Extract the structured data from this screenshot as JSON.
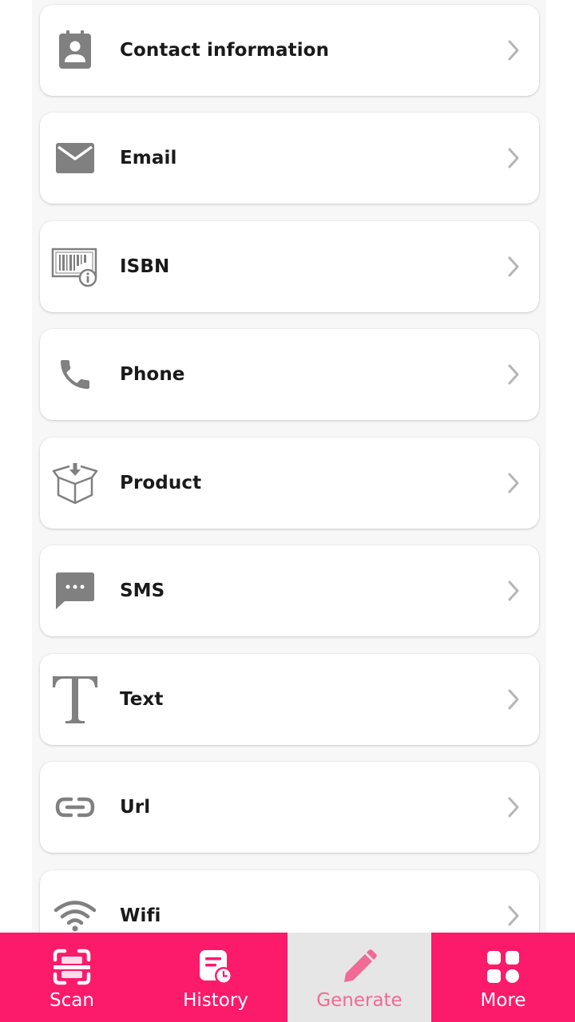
{
  "list": {
    "items": [
      {
        "label": "Contact information",
        "icon": "contact-card-icon"
      },
      {
        "label": "Email",
        "icon": "envelope-icon"
      },
      {
        "label": "ISBN",
        "icon": "barcode-info-icon"
      },
      {
        "label": "Phone",
        "icon": "phone-icon"
      },
      {
        "label": "Product",
        "icon": "box-icon"
      },
      {
        "label": "SMS",
        "icon": "chat-bubble-icon"
      },
      {
        "label": "Text",
        "icon": "text-t-icon"
      },
      {
        "label": "Url",
        "icon": "link-icon"
      },
      {
        "label": "Wifi",
        "icon": "wifi-icon"
      }
    ]
  },
  "nav": {
    "items": [
      {
        "label": "Scan",
        "icon": "scan-icon"
      },
      {
        "label": "History",
        "icon": "history-icon"
      },
      {
        "label": "Generate",
        "icon": "pencil-icon",
        "active": true
      },
      {
        "label": "More",
        "icon": "grid-icon"
      }
    ]
  },
  "colors": {
    "accent": "#fc1a6a",
    "active_nav_bg": "#e6e6e6",
    "active_nav_fg": "#f06a95",
    "icon_gray": "#808080",
    "chevron": "#b5b5b5"
  }
}
